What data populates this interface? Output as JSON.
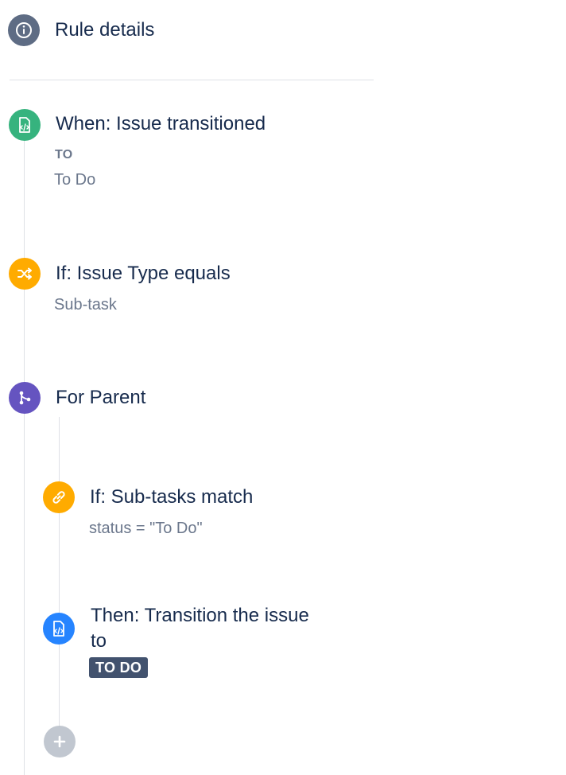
{
  "header": {
    "title": "Rule details"
  },
  "trigger": {
    "title": "When: Issue transitioned",
    "field_label": "TO",
    "field_value": "To Do"
  },
  "condition": {
    "title": "If: Issue Type equals",
    "value": "Sub-task"
  },
  "branch": {
    "title": "For Parent"
  },
  "branch_condition": {
    "title": "If: Sub-tasks match",
    "value": "status = \"To Do\""
  },
  "branch_action": {
    "title_line1": "Then: Transition the issue",
    "title_line2": "to",
    "status_lozenge": "TO DO"
  },
  "colors": {
    "info": "#5e6c84",
    "trigger": "#36b37e",
    "condition": "#ffab00",
    "branch": "#6554c0",
    "action": "#2684ff",
    "add": "#c1c7d0",
    "lozenge": "#42526e"
  },
  "icons": {
    "header": "info-icon",
    "trigger": "issue-transition-icon",
    "condition": "shuffle-icon",
    "branch": "branch-icon",
    "branch_condition": "link-icon",
    "branch_action": "issue-transition-icon",
    "add": "plus-icon"
  }
}
